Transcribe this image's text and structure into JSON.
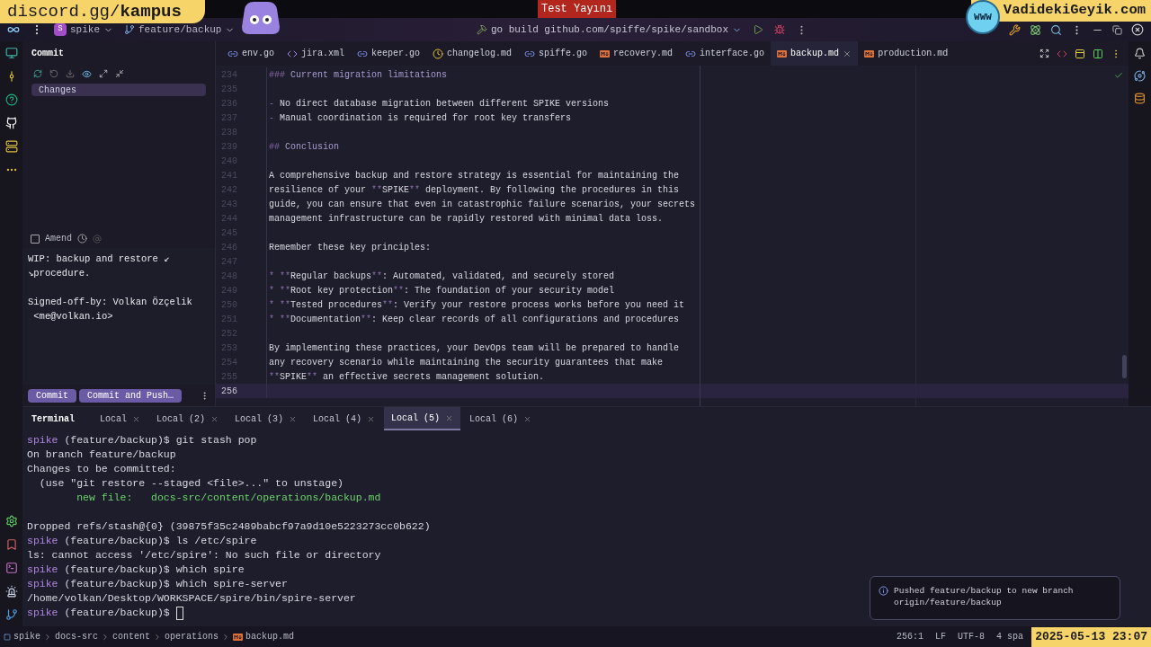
{
  "overlays": {
    "discord_banner": "discord.gg/**kampus**",
    "live_badge": "Test Yayını",
    "globe_label": "WWW",
    "site_banner": "VadidekiGeyik.com",
    "timestamp": "2025-05-13 23:07"
  },
  "toolbar": {
    "project_initial": "S",
    "project": "spike",
    "branch": "feature/backup",
    "run_config": "go build github.com/spiffe/spike/sandbox"
  },
  "commit_panel": {
    "title": "Commit",
    "changes_label": "Changes",
    "amend": {
      "label": "Amend",
      "checked": false
    },
    "message": [
      [
        "WIP: backup and restore ↙",
        "↘procedure."
      ],
      [
        "Signed-off-by: Volkan Özçelik",
        " <me@volkan.io>"
      ]
    ],
    "buttons": [
      "Commit",
      "Commit and Push…"
    ]
  },
  "editor_tabs": [
    {
      "label": "env.go",
      "kind": "go",
      "selected": false
    },
    {
      "label": "jira.xml",
      "kind": "xml",
      "selected": false
    },
    {
      "label": "keeper.go",
      "kind": "go",
      "selected": false
    },
    {
      "label": "changelog.md",
      "kind": "changelog",
      "selected": false
    },
    {
      "label": "spiffe.go",
      "kind": "go",
      "selected": false
    },
    {
      "label": "recovery.md",
      "kind": "markdown",
      "selected": false
    },
    {
      "label": "interface.go",
      "kind": "go",
      "selected": false
    },
    {
      "label": "backup.md",
      "kind": "markdown",
      "selected": true
    },
    {
      "label": "production.md",
      "kind": "markdown",
      "selected": false
    }
  ],
  "editor_lines": [
    {
      "number": "234",
      "current": false,
      "segments": [
        {
          "kind": "marker",
          "text": "###"
        },
        {
          "kind": "heading",
          "text": " Current migration limitations"
        }
      ]
    },
    {
      "number": "235",
      "current": false
    },
    {
      "number": "236",
      "current": false,
      "segments": [
        {
          "kind": "marker",
          "text": "-"
        },
        {
          "kind": "text",
          "text": " No direct database migration between different SPIKE versions"
        }
      ]
    },
    {
      "number": "237",
      "current": false,
      "segments": [
        {
          "kind": "marker",
          "text": "-"
        },
        {
          "kind": "text",
          "text": " Manual coordination is required for root key transfers"
        }
      ]
    },
    {
      "number": "238",
      "current": false
    },
    {
      "number": "239",
      "current": false,
      "segments": [
        {
          "kind": "marker",
          "text": "##"
        },
        {
          "kind": "heading",
          "text": " Conclusion"
        }
      ]
    },
    {
      "number": "240",
      "current": false
    },
    {
      "number": "241",
      "current": false,
      "segments": [
        {
          "kind": "text",
          "text": "A comprehensive backup and restore strategy is essential for maintaining the"
        }
      ]
    },
    {
      "number": "242",
      "current": false,
      "segments": [
        {
          "kind": "text",
          "text": "resilience of your "
        },
        {
          "kind": "marker",
          "text": "**"
        },
        {
          "kind": "text",
          "text": "SPIKE"
        },
        {
          "kind": "marker",
          "text": "**"
        },
        {
          "kind": "text",
          "text": " deployment. By following the procedures in this"
        }
      ]
    },
    {
      "number": "243",
      "current": false,
      "segments": [
        {
          "kind": "text",
          "text": "guide, you can ensure that even in catastrophic failure scenarios, your secrets"
        }
      ]
    },
    {
      "number": "244",
      "current": false,
      "segments": [
        {
          "kind": "text",
          "text": "management infrastructure can be rapidly restored with minimal data loss."
        }
      ]
    },
    {
      "number": "245",
      "current": false
    },
    {
      "number": "246",
      "current": false,
      "segments": [
        {
          "kind": "text",
          "text": "Remember these key principles:"
        }
      ]
    },
    {
      "number": "247",
      "current": false
    },
    {
      "number": "248",
      "current": false,
      "segments": [
        {
          "kind": "marker",
          "text": "* **"
        },
        {
          "kind": "text",
          "text": "Regular backups"
        },
        {
          "kind": "marker",
          "text": "**"
        },
        {
          "kind": "text",
          "text": ": Automated, validated, and securely stored"
        }
      ]
    },
    {
      "number": "249",
      "current": false,
      "segments": [
        {
          "kind": "marker",
          "text": "* **"
        },
        {
          "kind": "text",
          "text": "Root key protection"
        },
        {
          "kind": "marker",
          "text": "**"
        },
        {
          "kind": "text",
          "text": ": The foundation of your security model"
        }
      ]
    },
    {
      "number": "250",
      "current": false,
      "segments": [
        {
          "kind": "marker",
          "text": "* **"
        },
        {
          "kind": "text",
          "text": "Tested procedures"
        },
        {
          "kind": "marker",
          "text": "**"
        },
        {
          "kind": "text",
          "text": ": Verify your restore process works before you need it"
        }
      ]
    },
    {
      "number": "251",
      "current": false,
      "segments": [
        {
          "kind": "marker",
          "text": "* **"
        },
        {
          "kind": "text",
          "text": "Documentation"
        },
        {
          "kind": "marker",
          "text": "**"
        },
        {
          "kind": "text",
          "text": ": Keep clear records of all configurations and procedures"
        }
      ]
    },
    {
      "number": "252",
      "current": false
    },
    {
      "number": "253",
      "current": false,
      "segments": [
        {
          "kind": "text",
          "text": "By implementing these practices, your DevOps team will be prepared to handle"
        }
      ]
    },
    {
      "number": "254",
      "current": false,
      "segments": [
        {
          "kind": "text",
          "text": "any recovery scenario while maintaining the security guarantees that make"
        }
      ]
    },
    {
      "number": "255",
      "current": false,
      "segments": [
        {
          "kind": "marker",
          "text": "**"
        },
        {
          "kind": "text",
          "text": "SPIKE"
        },
        {
          "kind": "marker",
          "text": "**"
        },
        {
          "kind": "text",
          "text": " an effective secrets management solution."
        }
      ]
    },
    {
      "number": "256",
      "current": true
    }
  ],
  "terminal": {
    "title": "Terminal",
    "tabs": [
      {
        "label": "Local",
        "selected": false
      },
      {
        "label": "Local (2)",
        "selected": false
      },
      {
        "label": "Local (3)",
        "selected": false
      },
      {
        "label": "Local (4)",
        "selected": false
      },
      {
        "label": "Local (5)",
        "selected": true
      },
      {
        "label": "Local (6)",
        "selected": false
      }
    ],
    "lines": [
      {
        "kind": "output",
        "cursor": false,
        "segments": [
          {
            "kind": "prompt",
            "text": "spike"
          },
          {
            "kind": "text",
            "text": " (feature/backup)$ git stash pop"
          }
        ]
      },
      {
        "kind": "output",
        "cursor": false,
        "segments": [
          {
            "kind": "text",
            "text": "On branch feature/backup"
          }
        ]
      },
      {
        "kind": "output",
        "cursor": false,
        "segments": [
          {
            "kind": "text",
            "text": "Changes to be committed:"
          }
        ]
      },
      {
        "kind": "output",
        "cursor": false,
        "segments": [
          {
            "kind": "text",
            "text": "  (use \"git restore --staged <file>...\" to unstage)"
          }
        ]
      },
      {
        "kind": "output",
        "cursor": false,
        "segments": [
          {
            "kind": "added",
            "text": "        new file:   docs-src/content/operations/backup.md"
          }
        ]
      },
      {
        "kind": "blank",
        "cursor": false
      },
      {
        "kind": "output",
        "cursor": false,
        "segments": [
          {
            "kind": "text",
            "text": "Dropped refs/stash@{0} (39875f35c2489babcf97a9d10e5223273cc0b622)"
          }
        ]
      },
      {
        "kind": "output",
        "cursor": false,
        "segments": [
          {
            "kind": "prompt",
            "text": "spike"
          },
          {
            "kind": "text",
            "text": " (feature/backup)$ ls /etc/spire"
          }
        ]
      },
      {
        "kind": "output",
        "cursor": false,
        "segments": [
          {
            "kind": "text",
            "text": "ls: cannot access '/etc/spire': No such file or directory"
          }
        ]
      },
      {
        "kind": "output",
        "cursor": false,
        "segments": [
          {
            "kind": "prompt",
            "text": "spike"
          },
          {
            "kind": "text",
            "text": " (feature/backup)$ which spire"
          }
        ]
      },
      {
        "kind": "output",
        "cursor": false,
        "segments": [
          {
            "kind": "prompt",
            "text": "spike"
          },
          {
            "kind": "text",
            "text": " (feature/backup)$ which spire-server"
          }
        ]
      },
      {
        "kind": "output",
        "cursor": false,
        "segments": [
          {
            "kind": "text",
            "text": "/home/volkan/Desktop/WORKSPACE/spire/bin/spire-server"
          }
        ]
      },
      {
        "kind": "output",
        "cursor": true,
        "segments": [
          {
            "kind": "prompt",
            "text": "spike"
          },
          {
            "kind": "text",
            "text": " (feature/backup)$"
          }
        ]
      }
    ]
  },
  "notification": "Pushed feature/backup to new branch origin/feature/backup",
  "breadcrumbs": [
    "spike",
    "docs-src",
    "content",
    "operations",
    "backup.md"
  ],
  "status_items": [
    "256:1",
    "LF",
    "UTF-8",
    "4 spa"
  ]
}
